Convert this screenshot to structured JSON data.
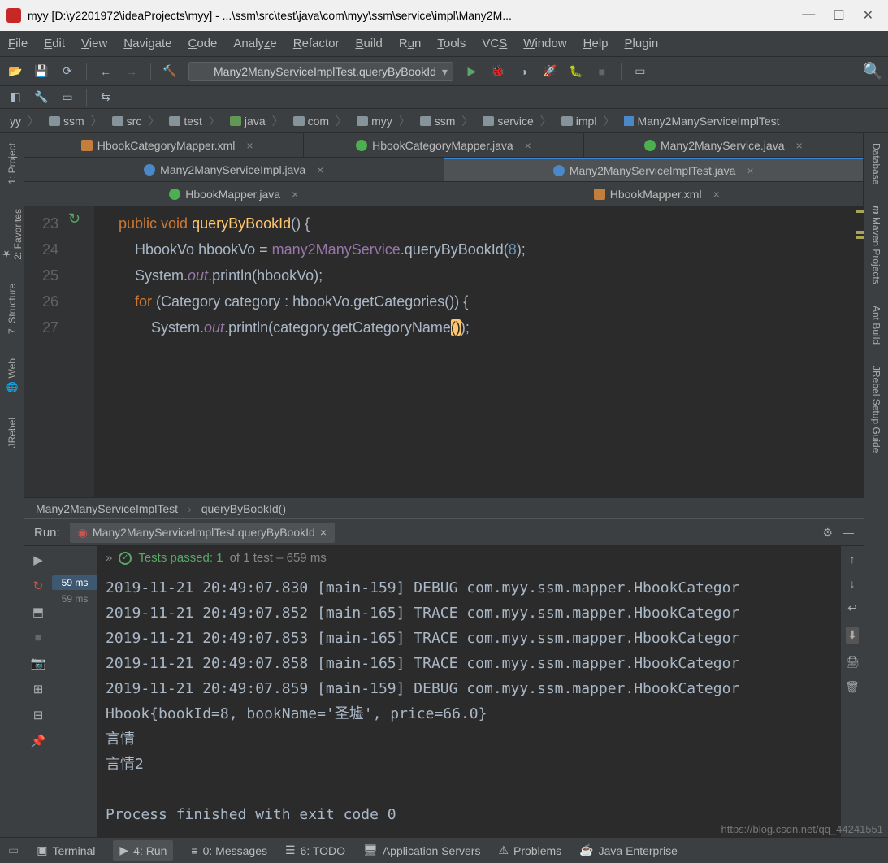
{
  "window": {
    "title": "myy [D:\\y2201972\\ideaProjects\\myy] - ...\\ssm\\src\\test\\java\\com\\myy\\ssm\\service\\impl\\Many2M..."
  },
  "menu": [
    "File",
    "Edit",
    "View",
    "Navigate",
    "Code",
    "Analyze",
    "Refactor",
    "Build",
    "Run",
    "Tools",
    "VCS",
    "Window",
    "Help",
    "Plugin"
  ],
  "run_config": "Many2ManyServiceImplTest.queryByBookId",
  "breadcrumb": [
    "yy",
    "ssm",
    "src",
    "test",
    "java",
    "com",
    "myy",
    "ssm",
    "service",
    "impl",
    "Many2ManyServiceImplTest"
  ],
  "tabs": {
    "row1": [
      {
        "label": "HbookCategoryMapper.xml",
        "icon": "x"
      },
      {
        "label": "HbookCategoryMapper.java",
        "icon": "i"
      },
      {
        "label": "Many2ManyService.java",
        "icon": "i"
      }
    ],
    "row2": [
      {
        "label": "Many2ManyServiceImpl.java",
        "icon": "c"
      },
      {
        "label": "Many2ManyServiceImplTest.java",
        "icon": "c",
        "active": true
      }
    ],
    "row3": [
      {
        "label": "HbookMapper.java",
        "icon": "i"
      },
      {
        "label": "HbookMapper.xml",
        "icon": "x"
      }
    ]
  },
  "editor": {
    "lines": [
      23,
      24,
      25,
      26,
      27
    ],
    "trail": [
      "Many2ManyServiceImplTest",
      "queryByBookId()"
    ]
  },
  "run": {
    "title": "Run:",
    "tab": "Many2ManyServiceImplTest.queryByBookId",
    "tests_line_prefix": "Tests passed: 1",
    "tests_line_suffix": " of 1 test – 659 ms",
    "time1": "59 ms",
    "time2": "59 ms",
    "console": "2019-11-21 20:49:07.830 [main-159] DEBUG com.myy.ssm.mapper.HbookCategor\n2019-11-21 20:49:07.852 [main-165] TRACE com.myy.ssm.mapper.HbookCategor\n2019-11-21 20:49:07.853 [main-165] TRACE com.myy.ssm.mapper.HbookCategor\n2019-11-21 20:49:07.858 [main-165] TRACE com.myy.ssm.mapper.HbookCategor\n2019-11-21 20:49:07.859 [main-159] DEBUG com.myy.ssm.mapper.HbookCategor\nHbook{bookId=8, bookName='圣墟', price=66.0}\n言情\n言情2\n\nProcess finished with exit code 0"
  },
  "left_tools": [
    "1: Project",
    "2: Favorites",
    "7: Structure",
    "Web",
    "JRebel"
  ],
  "right_tools": [
    "Database",
    "Maven Projects",
    "Ant Build",
    "JRebel Setup Guide"
  ],
  "bottom": [
    "Terminal",
    "4: Run",
    "0: Messages",
    "6: TODO",
    "Application Servers",
    "Problems",
    "Java Enterprise"
  ],
  "watermark": "https://blog.csdn.net/qq_44241551"
}
